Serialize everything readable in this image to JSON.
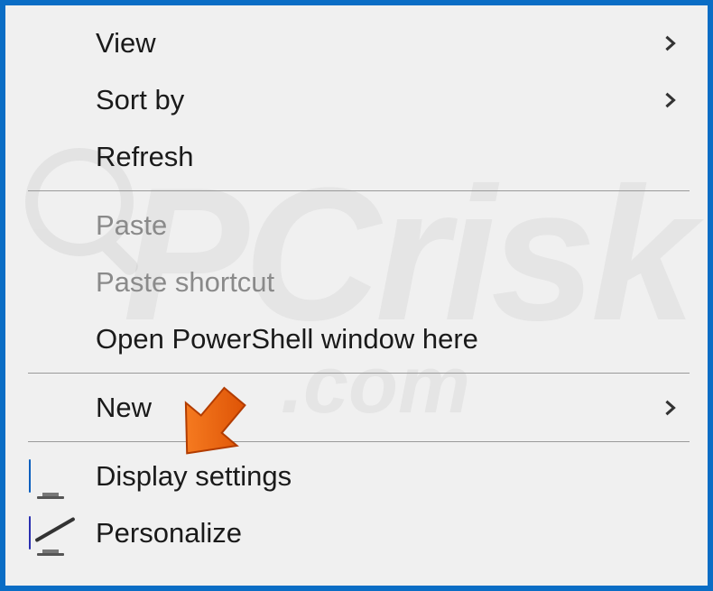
{
  "menu": {
    "items": [
      {
        "label": "View",
        "disabled": false,
        "submenu": true,
        "icon": null
      },
      {
        "label": "Sort by",
        "disabled": false,
        "submenu": true,
        "icon": null
      },
      {
        "label": "Refresh",
        "disabled": false,
        "submenu": false,
        "icon": null
      },
      {
        "separator": true
      },
      {
        "label": "Paste",
        "disabled": true,
        "submenu": false,
        "icon": null
      },
      {
        "label": "Paste shortcut",
        "disabled": true,
        "submenu": false,
        "icon": null
      },
      {
        "label": "Open PowerShell window here",
        "disabled": false,
        "submenu": false,
        "icon": null
      },
      {
        "separator": true
      },
      {
        "label": "New",
        "disabled": false,
        "submenu": true,
        "icon": null
      },
      {
        "separator": true
      },
      {
        "label": "Display settings",
        "disabled": false,
        "submenu": false,
        "icon": "monitor"
      },
      {
        "label": "Personalize",
        "disabled": false,
        "submenu": false,
        "icon": "monitor-personalize"
      }
    ]
  },
  "watermark": {
    "text_main": "PCrisk",
    "text_sub": ".com"
  },
  "annotation": {
    "type": "arrow",
    "color": "#e65a00",
    "target_item": "Display settings"
  }
}
